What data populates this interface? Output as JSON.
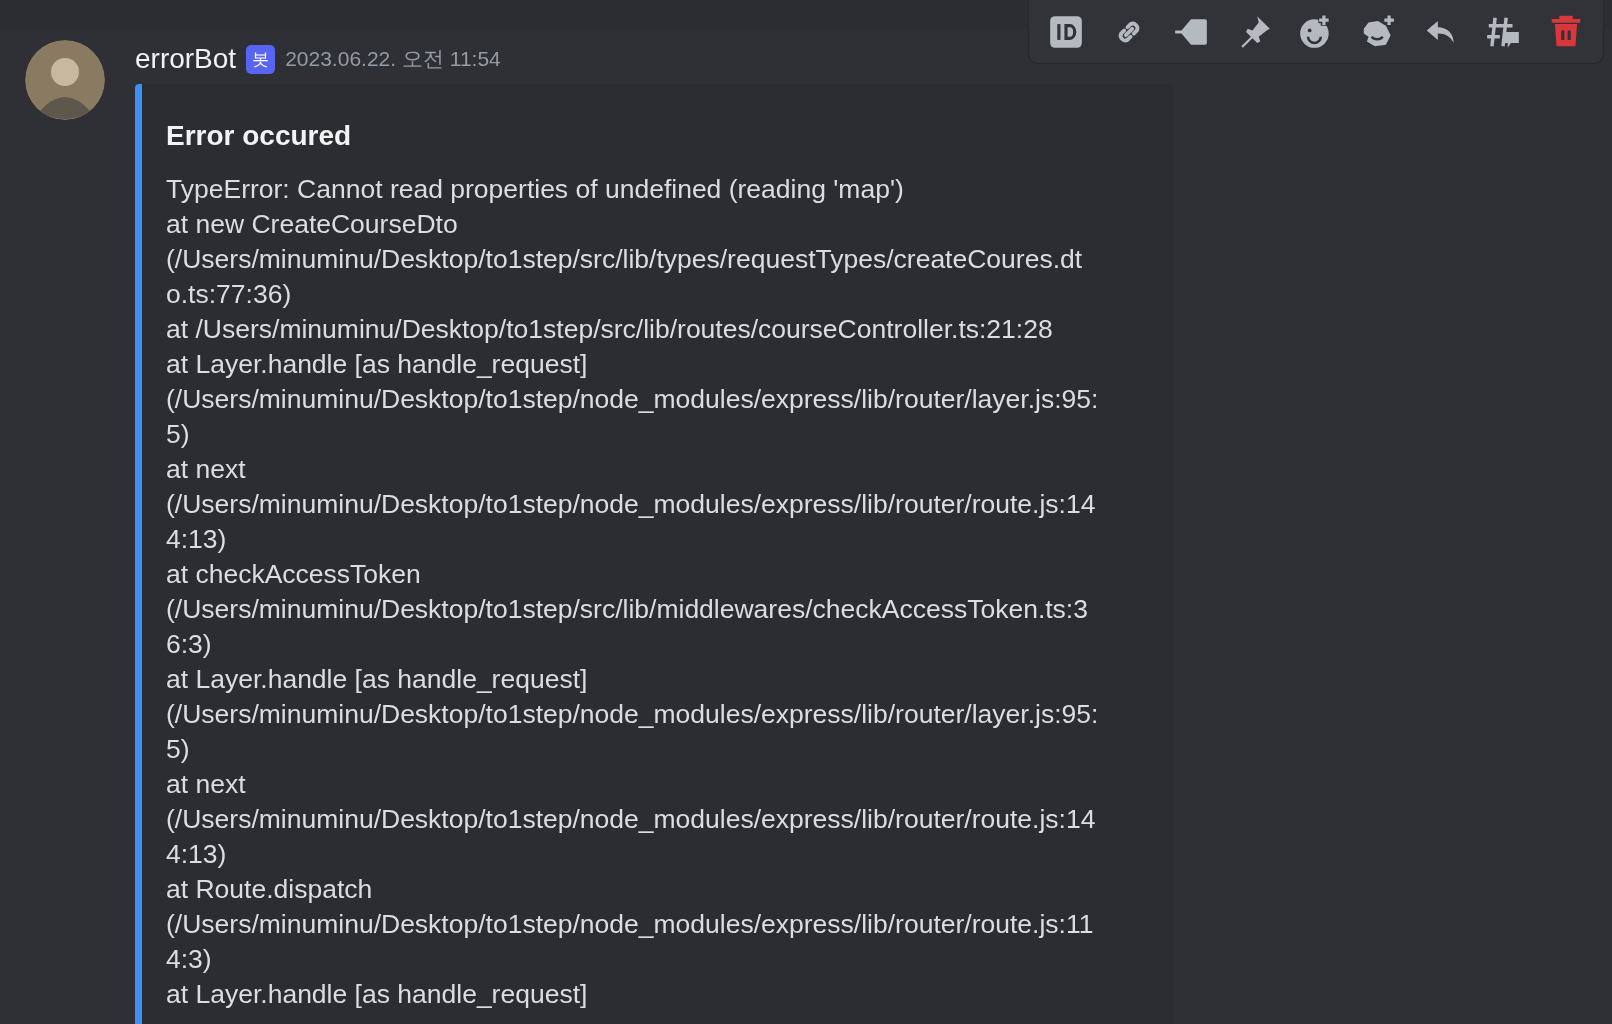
{
  "toolbar": {
    "buttons": [
      {
        "kind": "id"
      },
      {
        "kind": "link"
      },
      {
        "kind": "tag"
      },
      {
        "kind": "pin"
      },
      {
        "kind": "reaction"
      },
      {
        "kind": "super-reaction"
      },
      {
        "kind": "reply"
      },
      {
        "kind": "thread"
      },
      {
        "kind": "delete"
      }
    ]
  },
  "message": {
    "author": "errorBot",
    "badge": "봇",
    "timestamp": "2023.06.22. 오전 11:54",
    "embed": {
      "title": "Error occured",
      "lines": [
        "TypeError: Cannot read properties of undefined (reading 'map')",
        "at new CreateCourseDto",
        "(/Users/minuminu/Desktop/to1step/src/lib/types/requestTypes/createCoures.dt",
        "o.ts:77:36)",
        "at /Users/minuminu/Desktop/to1step/src/lib/routes/courseController.ts:21:28",
        "at Layer.handle [as handle_request]",
        "(/Users/minuminu/Desktop/to1step/node_modules/express/lib/router/layer.js:95:",
        "5)",
        "at next",
        "(/Users/minuminu/Desktop/to1step/node_modules/express/lib/router/route.js:14",
        "4:13)",
        "at checkAccessToken",
        "(/Users/minuminu/Desktop/to1step/src/lib/middlewares/checkAccessToken.ts:3",
        "6:3)",
        "at Layer.handle [as handle_request]",
        "(/Users/minuminu/Desktop/to1step/node_modules/express/lib/router/layer.js:95:",
        "5)",
        "at next",
        "(/Users/minuminu/Desktop/to1step/node_modules/express/lib/router/route.js:14",
        "4:13)",
        "at Route.dispatch",
        "(/Users/minuminu/Desktop/to1step/node_modules/express/lib/router/route.js:11",
        "4:3)",
        "at Layer.handle [as handle_request]"
      ]
    }
  }
}
